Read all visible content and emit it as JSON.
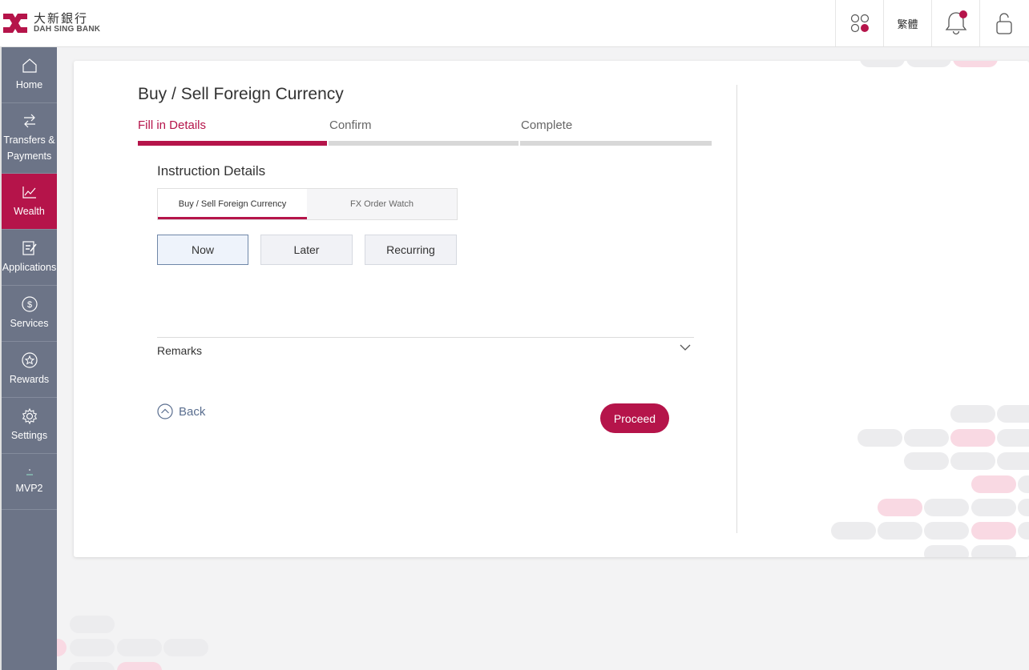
{
  "brand": {
    "name_cn": "大新銀行",
    "name_en": "DAH SING BANK",
    "color": "#b5144a"
  },
  "header": {
    "apps_icon": "apps-grid-icon",
    "language_label": "繁體",
    "notification_icon": "bell-icon",
    "lock_icon": "lock-icon"
  },
  "sidebar": {
    "items": [
      {
        "label": "Home",
        "icon": "home-icon"
      },
      {
        "label": "Transfers &\nPayments",
        "icon": "transfer-icon"
      },
      {
        "label": "Wealth",
        "icon": "chart-icon",
        "active": true
      },
      {
        "label": "Applications",
        "icon": "form-icon"
      },
      {
        "label": "Services",
        "icon": "dollar-icon"
      },
      {
        "label": "Rewards",
        "icon": "star-icon"
      },
      {
        "label": "Settings",
        "icon": "gear-icon"
      },
      {
        "label": "MVP2",
        "icon": "dash-icon"
      }
    ]
  },
  "main": {
    "title": "Buy / Sell Foreign Currency",
    "steps": [
      {
        "label": "Fill in Details",
        "active": true
      },
      {
        "label": "Confirm",
        "active": false
      },
      {
        "label": "Complete",
        "active": false
      }
    ],
    "section_title": "Instruction Details",
    "tabs": [
      {
        "label": "Buy / Sell Foreign Currency",
        "active": true
      },
      {
        "label": "FX Order Watch",
        "active": false
      }
    ],
    "timing_options": [
      {
        "label": "Now",
        "selected": true
      },
      {
        "label": "Later",
        "selected": false
      },
      {
        "label": "Recurring",
        "selected": false
      }
    ],
    "remarks_label": "Remarks",
    "back_label": "Back",
    "proceed_label": "Proceed"
  }
}
